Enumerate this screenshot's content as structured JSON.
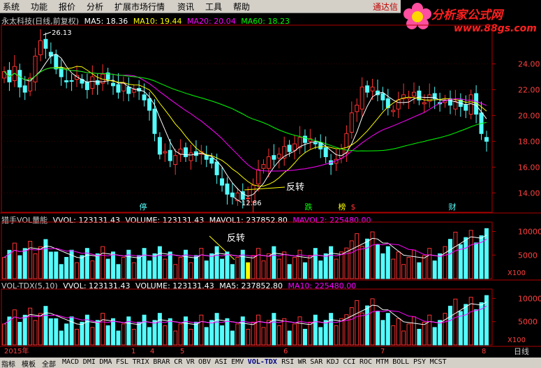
{
  "menu": [
    "系统",
    "功能",
    "报价",
    "分析",
    "扩展市场行情",
    "资讯",
    "工具",
    "帮助"
  ],
  "broker": "通达信",
  "logo": {
    "name": "分析家公式网",
    "url": "www.88gs.com"
  },
  "main_header": {
    "name": "永太科技(日线,前复权)",
    "ma5": "MA5: 18.36",
    "ma10": "MA10: 19.44",
    "ma20": "MA20: 20.04",
    "ma60": "MA60: 18.23"
  },
  "vol_header": {
    "name": "猎手VOL量能",
    "vvol": "VVOL: 123131.43",
    "volume": "VOLUME: 123131.43",
    "mavol1": "MAVOL1: 237852.80",
    "mavol2": "MAVOL2: 225480.00"
  },
  "tdx_header": {
    "name": "VOL-TDX(5,10)",
    "vvol": "VVOL: 123131.43",
    "volume": "VOLUME: 123131.43",
    "ma5": "MA5: 237852.80",
    "ma10": "MA10: 225480.00"
  },
  "annotations": {
    "reversal": "反转",
    "reversal2": "反转",
    "high": "26.13",
    "low": "12.86"
  },
  "markers": [
    "停",
    "跌",
    "榜",
    "$",
    "财"
  ],
  "x_labels": [
    "2015年",
    "1",
    "4",
    "5",
    "6",
    "7",
    "8"
  ],
  "axis_right_label": "日线",
  "vol_unit": "X100",
  "tabs": [
    "指标",
    "模板",
    "全部",
    "MACD",
    "DMI",
    "DMA",
    "FSL",
    "TRIX",
    "BRAR",
    "CR",
    "VR",
    "OBV",
    "ASI",
    "EMV",
    "VOL-TDX",
    "RSI",
    "WR",
    "SAR",
    "KDJ",
    "CCI",
    "ROC",
    "MTM",
    "BOLL",
    "PSY",
    "MCST"
  ],
  "selected_tab": "VOL-TDX",
  "colors": {
    "up": "#ff3232",
    "down": "#54fcfc",
    "ma5": "#ffffff",
    "ma10": "#ffff00",
    "ma20": "#ff00ff",
    "ma60": "#00ff00",
    "axis": "#b00000"
  },
  "chart_data": [
    {
      "type": "candlestick",
      "title": "永太科技(日线,前复权)",
      "ylim": [
        12.5,
        27
      ],
      "yticks": [
        14.0,
        16.0,
        18.0,
        20.0,
        22.0,
        24.0
      ],
      "series": [
        {
          "name": "MA5",
          "last": 18.36
        },
        {
          "name": "MA10",
          "last": 19.44
        },
        {
          "name": "MA20",
          "last": 20.04
        },
        {
          "name": "MA60",
          "last": 18.23
        }
      ],
      "high": 26.13,
      "low": 12.86,
      "closes": [
        23.4,
        22.6,
        23.8,
        22.2,
        21.8,
        22.9,
        24.6,
        25.8,
        25.2,
        24.6,
        23.6,
        23.0,
        22.6,
        22.7,
        23.1,
        22.5,
        22.0,
        23.0,
        22.4,
        23.2,
        22.8,
        22.3,
        21.8,
        22.5,
        21.7,
        22.0,
        21.9,
        21.2,
        20.4,
        18.6,
        17.0,
        17.2,
        16.5,
        16.9,
        17.4,
        16.8,
        17.1,
        16.9,
        17.2,
        16.6,
        16.3,
        15.4,
        14.6,
        13.9,
        13.7,
        14.0,
        13.5,
        13.6,
        14.6,
        15.8,
        16.2,
        16.8,
        16.6,
        17.0,
        17.6,
        17.2,
        17.8,
        18.3,
        17.9,
        18.2,
        17.8,
        17.4,
        16.8,
        16.2,
        16.6,
        17.4,
        18.6,
        20.2,
        20.8,
        22.2,
        21.8,
        22.2,
        21.6,
        21.2,
        20.6,
        20.4,
        21.2,
        21.6,
        21.4,
        21.8,
        21.2,
        21.0,
        21.6,
        21.3,
        20.9,
        21.2,
        20.8,
        21.1,
        20.7,
        20.4,
        21.6,
        20.1,
        18.6,
        18.0
      ],
      "volume_last": 123131.43,
      "mavol1": 237852.8,
      "mavol2": 225480.0
    }
  ]
}
